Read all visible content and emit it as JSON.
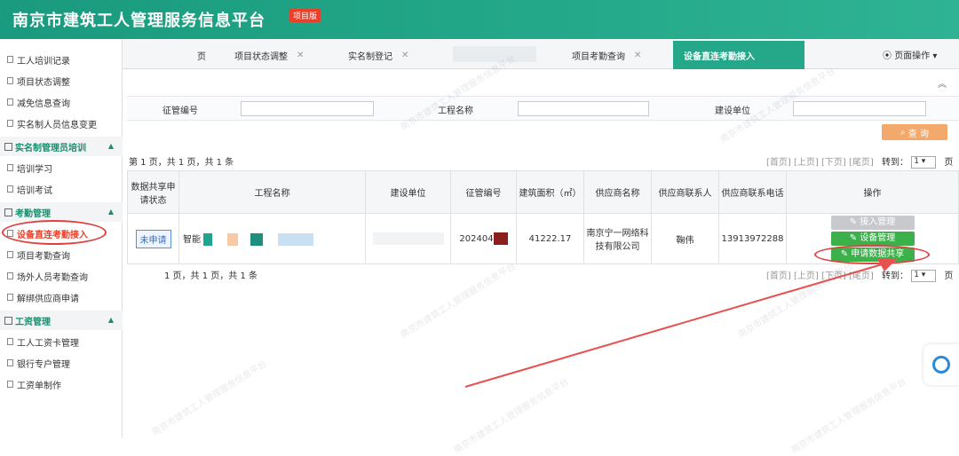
{
  "header": {
    "title": "南京市建筑工人管理服务信息平台",
    "badge": "项目版"
  },
  "sidebar": {
    "items_top": [
      {
        "label": "工人培训记录"
      },
      {
        "label": "项目状态调整"
      },
      {
        "label": "减免信息查询"
      },
      {
        "label": "实名制人员信息变更"
      }
    ],
    "group1": {
      "label": "实名制管理员培训",
      "items": [
        {
          "label": "培训学习"
        },
        {
          "label": "培训考试"
        }
      ]
    },
    "group2": {
      "label": "考勤管理",
      "items": [
        {
          "label": "设备直连考勤接入"
        },
        {
          "label": "项目考勤查询"
        },
        {
          "label": "场外人员考勤查询"
        },
        {
          "label": "解绑供应商申请"
        }
      ]
    },
    "group3": {
      "label": "工资管理",
      "items": [
        {
          "label": "工人工资卡管理"
        },
        {
          "label": "银行专户管理"
        },
        {
          "label": "工资单制作"
        }
      ]
    }
  },
  "tabs": [
    {
      "label": "页"
    },
    {
      "label": "项目状态调整"
    },
    {
      "label": "实名制登记"
    },
    {
      "label": "项目考勤查询"
    },
    {
      "label": "设备直连考勤接入"
    }
  ],
  "page_ops": "页面操作",
  "search": {
    "label1": "征管编号",
    "label2": "工程名称",
    "label3": "建设单位",
    "button": "查 询"
  },
  "pager": {
    "text_top": "第 1 页，共 1 页，共 1 条",
    "text_bottom": "1 页，共 1 页，共 1 条",
    "first": "[首页]",
    "prev": "[上页]",
    "next": "[下页]",
    "last": "[尾页]",
    "goto": "转到：",
    "page_select": "1",
    "page_unit": "页"
  },
  "table": {
    "headers": [
      "数据共享申请状态",
      "工程名称",
      "建设单位",
      "征管编号",
      "建筑面积（㎡）",
      "供应商名称",
      "供应商联系人",
      "供应商联系电话",
      "操作"
    ],
    "row": {
      "status": "未申请",
      "project_name_prefix": "智能",
      "permit_no_prefix": "202404",
      "area": "41222.17",
      "supplier": "南京宁一网络科技有限公司",
      "contact": "鞠伟",
      "phone": "13913972288",
      "ops": [
        "接入管理",
        "设备管理",
        "申请数据共享"
      ]
    }
  },
  "watermark": "南京市建筑工人管理服务信息平台",
  "colors": {
    "brand": "#24a98a",
    "accent_red": "#e04040",
    "query_btn": "#f3a96b",
    "op_green": "#3cb04a"
  }
}
